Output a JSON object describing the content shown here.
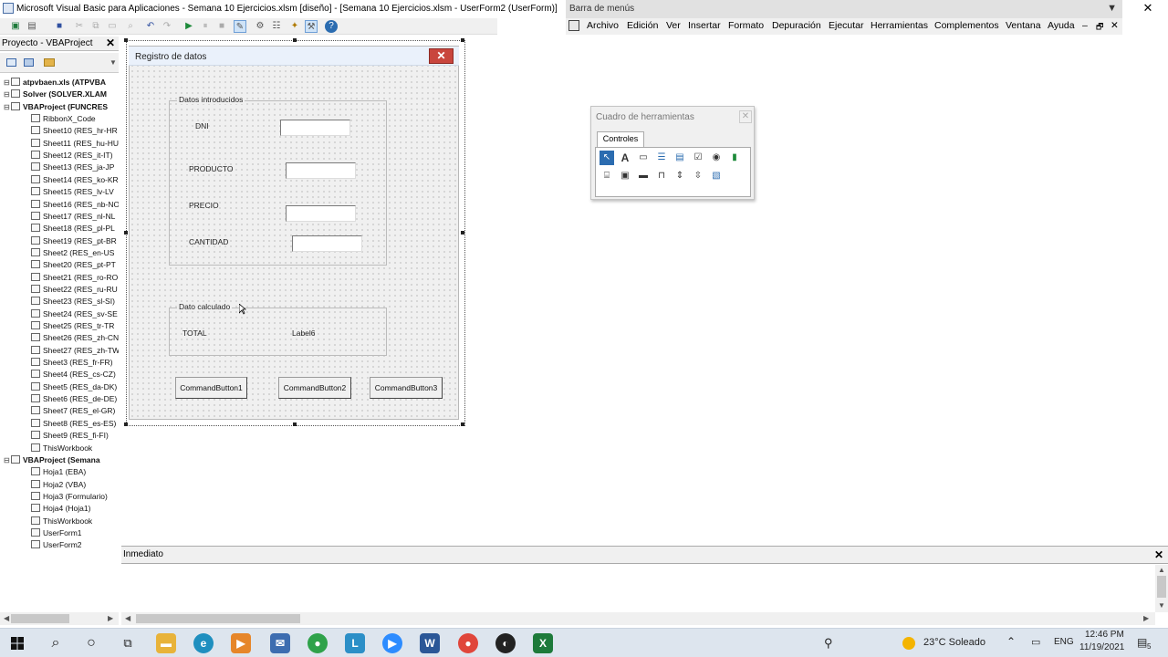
{
  "window": {
    "title": "Microsoft Visual Basic para Aplicaciones - Semana 10 Ejercicios.xlsm [diseño] - [Semana 10 Ejercicios.xlsm - UserForm2 (UserForm)]",
    "close_glyph": "✕"
  },
  "menubar": {
    "title": "Barra de menús",
    "items": [
      "Archivo",
      "Edición",
      "Ver",
      "Insertar",
      "Formato",
      "Depuración",
      "Ejecutar",
      "Herramientas",
      "Complementos",
      "Ventana",
      "Ayuda"
    ],
    "mdi_controls": [
      "‒",
      "🗗",
      "✕"
    ]
  },
  "project": {
    "title": "Proyecto - VBAProject",
    "close_glyph": "✕",
    "tree": [
      {
        "label": "atpvbaen.xls (ATPVBA",
        "level": 0,
        "root": true
      },
      {
        "label": "Solver (SOLVER.XLAM",
        "level": 0,
        "root": true
      },
      {
        "label": "VBAProject (FUNCRES",
        "level": 0,
        "root": true
      },
      {
        "label": "RibbonX_Code",
        "level": 1
      },
      {
        "label": "Sheet10 (RES_hr-HR",
        "level": 1
      },
      {
        "label": "Sheet11 (RES_hu-HU",
        "level": 1
      },
      {
        "label": "Sheet12 (RES_it-IT)",
        "level": 1
      },
      {
        "label": "Sheet13 (RES_ja-JP",
        "level": 1
      },
      {
        "label": "Sheet14 (RES_ko-KR",
        "level": 1
      },
      {
        "label": "Sheet15 (RES_lv-LV",
        "level": 1
      },
      {
        "label": "Sheet16 (RES_nb-NO",
        "level": 1
      },
      {
        "label": "Sheet17 (RES_nl-NL",
        "level": 1
      },
      {
        "label": "Sheet18 (RES_pl-PL",
        "level": 1
      },
      {
        "label": "Sheet19 (RES_pt-BR",
        "level": 1
      },
      {
        "label": "Sheet2 (RES_en-US",
        "level": 1
      },
      {
        "label": "Sheet20 (RES_pt-PT",
        "level": 1
      },
      {
        "label": "Sheet21 (RES_ro-RO",
        "level": 1
      },
      {
        "label": "Sheet22 (RES_ru-RU",
        "level": 1
      },
      {
        "label": "Sheet23 (RES_sl-SI)",
        "level": 1
      },
      {
        "label": "Sheet24 (RES_sv-SE",
        "level": 1
      },
      {
        "label": "Sheet25 (RES_tr-TR",
        "level": 1
      },
      {
        "label": "Sheet26 (RES_zh-CN",
        "level": 1
      },
      {
        "label": "Sheet27 (RES_zh-TW",
        "level": 1
      },
      {
        "label": "Sheet3 (RES_fr-FR)",
        "level": 1
      },
      {
        "label": "Sheet4 (RES_cs-CZ)",
        "level": 1
      },
      {
        "label": "Sheet5 (RES_da-DK)",
        "level": 1
      },
      {
        "label": "Sheet6 (RES_de-DE)",
        "level": 1
      },
      {
        "label": "Sheet7 (RES_el-GR)",
        "level": 1
      },
      {
        "label": "Sheet8 (RES_es-ES)",
        "level": 1
      },
      {
        "label": "Sheet9 (RES_fi-FI)",
        "level": 1
      },
      {
        "label": "ThisWorkbook",
        "level": 1
      },
      {
        "label": "VBAProject (Semana",
        "level": 0,
        "root": true
      },
      {
        "label": "Hoja1 (EBA)",
        "level": 1
      },
      {
        "label": "Hoja2 (VBA)",
        "level": 1
      },
      {
        "label": "Hoja3 (Formulario)",
        "level": 1
      },
      {
        "label": "Hoja4 (Hoja1)",
        "level": 1
      },
      {
        "label": "ThisWorkbook",
        "level": 1
      },
      {
        "label": "UserForm1",
        "level": 1
      },
      {
        "label": "UserForm2",
        "level": 1
      }
    ]
  },
  "userform": {
    "caption": "Registro de datos",
    "close_glyph": "✕",
    "frame1": {
      "caption": "Datos introducidos",
      "fields": [
        "DNI",
        "PRODUCTO",
        "PRECIO",
        "CANTIDAD"
      ]
    },
    "frame2": {
      "caption": "Dato calculado",
      "total_label": "TOTAL",
      "value_label": "Label6"
    },
    "buttons": [
      "CommandButton1",
      "CommandButton2",
      "CommandButton3"
    ]
  },
  "toolbox": {
    "title": "Cuadro de herramientas",
    "tab": "Controles",
    "close_glyph": "✕"
  },
  "immediate": {
    "title": "Inmediato",
    "close_glyph": "✕"
  },
  "taskbar": {
    "weather": "23°C Soleado",
    "language": "ENG",
    "time": "12:46 PM",
    "date": "11/19/2021",
    "notif_count": "5"
  },
  "colors": {
    "form_close": "#c9463d",
    "accent": "#2b6cb0"
  }
}
